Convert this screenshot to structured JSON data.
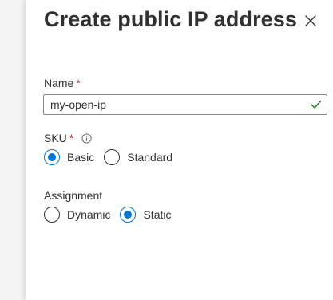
{
  "panel": {
    "title": "Create public IP address"
  },
  "name_field": {
    "label": "Name",
    "required_mark": "*",
    "value": "my-open-ip"
  },
  "sku": {
    "label": "SKU",
    "required_mark": "*",
    "options": [
      {
        "label": "Basic",
        "selected": true
      },
      {
        "label": "Standard",
        "selected": false
      }
    ]
  },
  "assignment": {
    "label": "Assignment",
    "options": [
      {
        "label": "Dynamic",
        "selected": false
      },
      {
        "label": "Static",
        "selected": true
      }
    ]
  },
  "icons": {
    "close": "close-icon",
    "info": "info-icon",
    "valid": "checkmark-icon"
  },
  "colors": {
    "accent": "#0078d4",
    "required": "#a4262c",
    "valid": "#107c10",
    "text": "#323130",
    "border": "#8a8886"
  }
}
